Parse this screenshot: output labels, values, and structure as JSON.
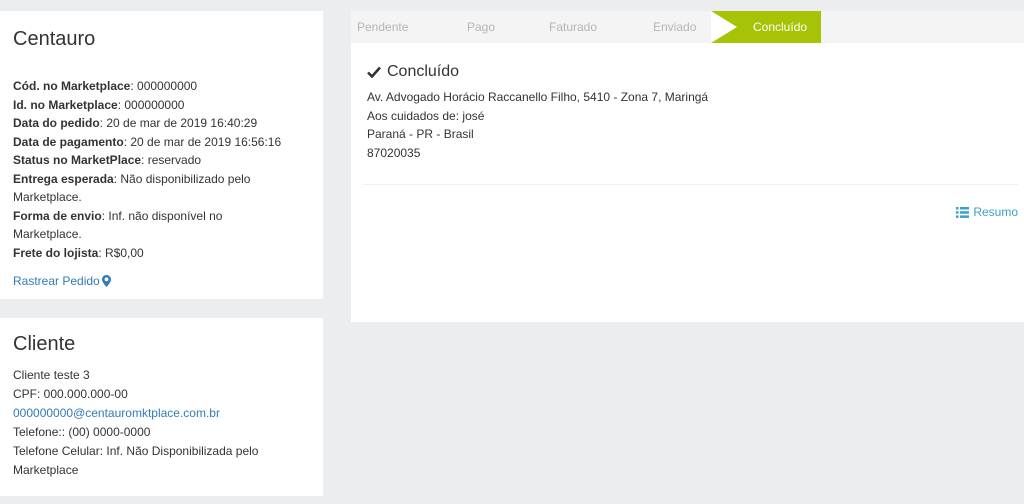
{
  "order": {
    "title": "Centauro",
    "fields": [
      {
        "label": "Cód. no Marketplace",
        "value": ": 000000000"
      },
      {
        "label": "Id. no Marketplace",
        "value": ": 000000000"
      },
      {
        "label": "Data do pedido",
        "value": ": 20 de mar de 2019 16:40:29"
      },
      {
        "label": "Data de pagamento",
        "value": ": 20 de mar de 2019 16:56:16"
      },
      {
        "label": "Status no MarketPlace",
        "value": ": reservado"
      },
      {
        "label": "Entrega esperada",
        "value": ": Não disponibilizado pelo"
      },
      {
        "label": "",
        "value": "Marketplace."
      },
      {
        "label": "Forma de envio",
        "value": ": Inf. não disponível no"
      },
      {
        "label": "",
        "value": "Marketplace."
      },
      {
        "label": "Frete do lojista",
        "value": ": R$0,00"
      }
    ],
    "track_label": "Rastrear Pedido",
    "track_icon": "map-marker-icon"
  },
  "client": {
    "title": "Cliente",
    "name": "Cliente teste 3",
    "cpf": "CPF: 000.000.000-00",
    "email": "000000000@centauromktplace.com.br",
    "phone": "Telefone:: (00) 0000-0000",
    "mobile_line1": "Telefone Celular: Inf. Não Disponibilizada pelo",
    "mobile_line2": "Marketplace"
  },
  "steps": {
    "items": [
      "Pendente",
      "Pago",
      "Faturado",
      "Enviado",
      "Concluído"
    ],
    "active": "Concluído",
    "active_color": "#a8c205",
    "inactive_color": "#b5b5b5"
  },
  "shipping": {
    "status_title": "Concluído",
    "status_icon": "check-icon",
    "address": "Av. Advogado Horácio Raccanello Filho, 5410 - Zona 7, Maringá",
    "care_of": "Aos cuidados de: josé",
    "state": "Paraná - PR - Brasil",
    "zip": "87020035"
  },
  "summary": {
    "label": "Resumo",
    "icon": "list-icon",
    "color": "#3aa0c4"
  }
}
